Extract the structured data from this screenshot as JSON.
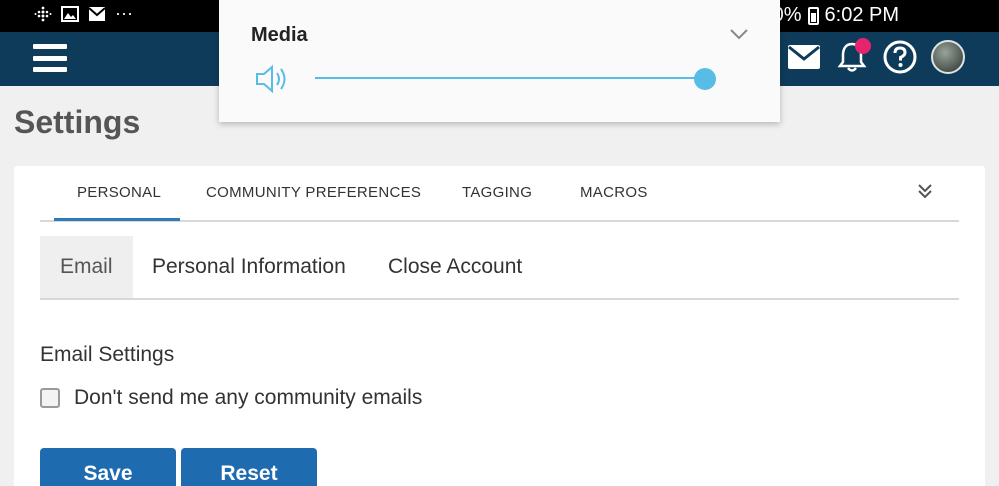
{
  "status_bar": {
    "icons": [
      "fitbit-icon",
      "gallery-icon",
      "gmail-icon",
      "more-dots-icon"
    ],
    "more_label": "···",
    "battery_percent_partial": "0%",
    "time": "6:02 PM"
  },
  "header": {
    "icons": [
      "hamburger-menu-icon",
      "mail-icon",
      "notification-bell-icon",
      "help-icon",
      "avatar"
    ],
    "notification_badge_color": "#e6246e",
    "bar_color": "#0f3b5a"
  },
  "volume_panel": {
    "title": "Media",
    "level": 1.0,
    "accent": "#58bde6"
  },
  "page": {
    "title": "Settings"
  },
  "tabs": {
    "items": [
      "PERSONAL",
      "COMMUNITY PREFERENCES",
      "TAGGING",
      "MACROS"
    ],
    "active": "PERSONAL"
  },
  "subtabs": {
    "items": [
      "Email",
      "Personal Information",
      "Close Account"
    ],
    "active": "Email"
  },
  "email_settings": {
    "title": "Email Settings",
    "checkbox_label": "Don't send me any community emails",
    "checked": false
  },
  "buttons": {
    "save": "Save",
    "reset": "Reset",
    "color": "#1f6bb0"
  }
}
